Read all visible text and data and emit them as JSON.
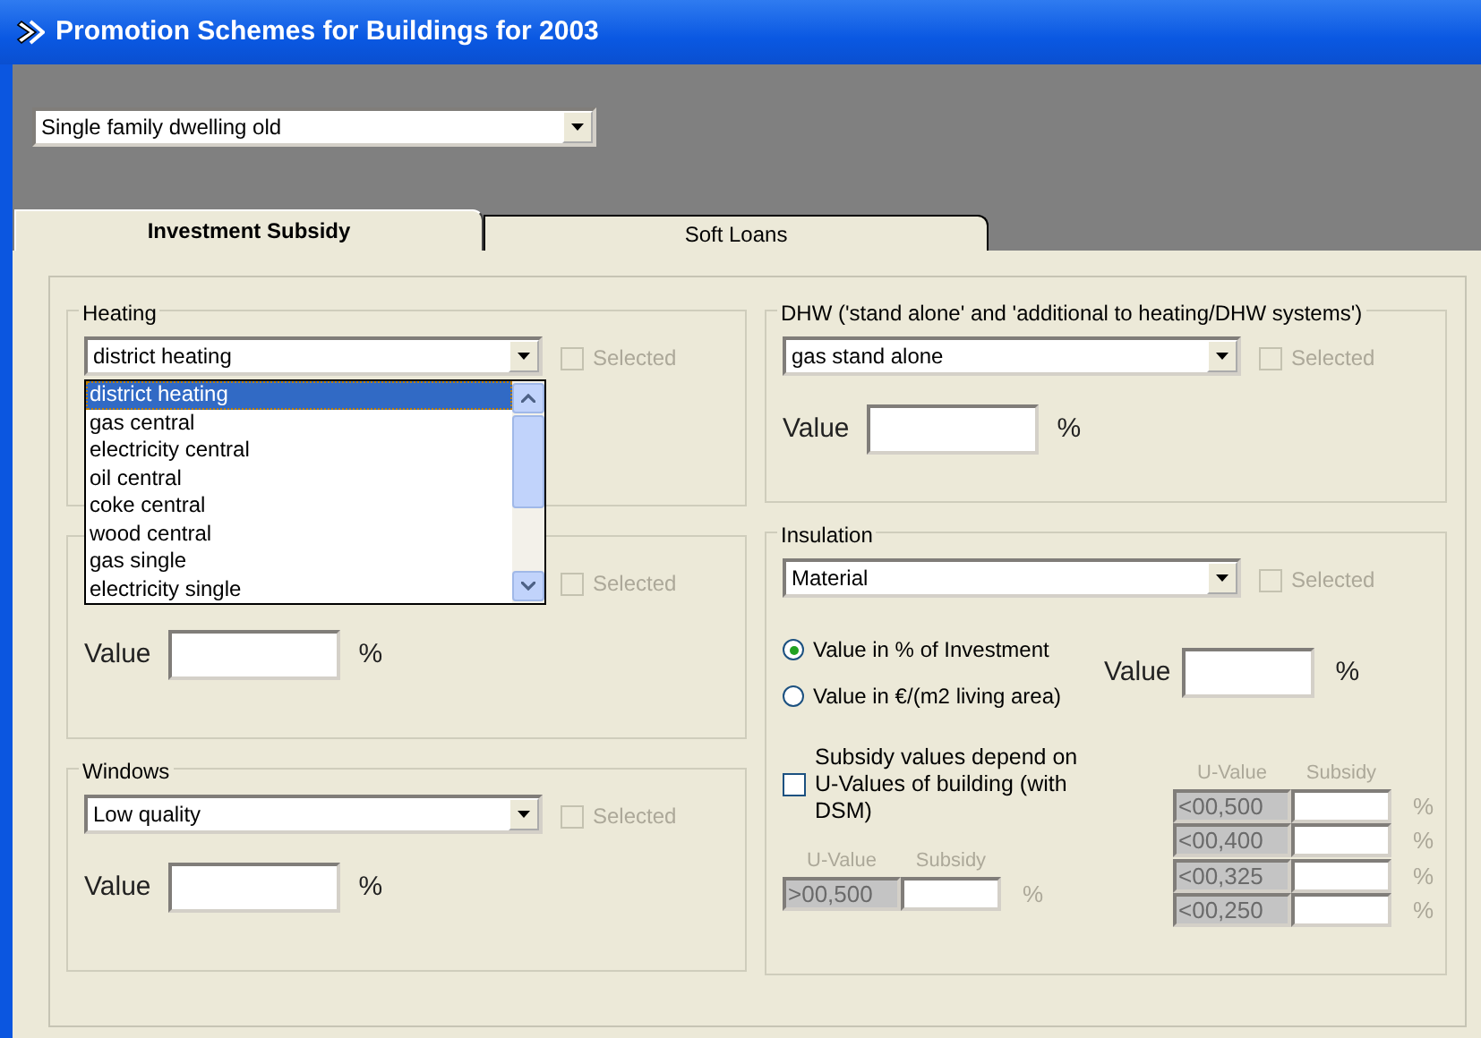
{
  "window": {
    "title": "Promotion Schemes for Buildings for 2003"
  },
  "building_type": {
    "value": "Single family dwelling old"
  },
  "tabs": [
    {
      "label": "Investment Subsidy",
      "selected": true
    },
    {
      "label": "Soft Loans",
      "selected": false
    }
  ],
  "left_column": [
    {
      "kind": "measure",
      "title": "Heating",
      "select": "district heating",
      "checkbox": {
        "label": "Selected",
        "checked": false,
        "disabled": true
      },
      "open_list": {
        "items": [
          {
            "label": "district heating",
            "selected": true
          },
          {
            "label": "gas central",
            "selected": false
          },
          {
            "label": "electricity central",
            "selected": false
          },
          {
            "label": "oil central",
            "selected": false
          },
          {
            "label": "coke central",
            "selected": false
          },
          {
            "label": "wood central",
            "selected": false
          },
          {
            "label": "gas single",
            "selected": false
          },
          {
            "label": "electricity single",
            "selected": false
          }
        ]
      }
    },
    {
      "kind": "measure",
      "checkbox": {
        "label": "Selected",
        "checked": false,
        "disabled": true
      },
      "value_label": "Value",
      "unit": "%"
    },
    {
      "kind": "measure",
      "title": "Windows",
      "select": "Low quality",
      "checkbox": {
        "label": "Selected",
        "checked": false,
        "disabled": true
      },
      "value_label": "Value",
      "unit": "%"
    }
  ],
  "right_column": [
    {
      "kind": "measure",
      "title": "DHW ('stand alone' and 'additional to heating/DHW systems')",
      "select": "gas stand alone",
      "checkbox": {
        "label": "Selected",
        "checked": false,
        "disabled": true
      },
      "value_label": "Value",
      "unit": "%"
    },
    {
      "kind": "insulation",
      "title": "Insulation",
      "select": "Material",
      "checkbox": {
        "label": "Selected",
        "checked": false,
        "disabled": true
      },
      "radios": [
        {
          "label": "Value in % of Investment",
          "selected": true
        },
        {
          "label": "Value in €/(m2 living area)",
          "selected": false
        }
      ],
      "value_label": "Value",
      "unit": "%",
      "dsm_checkbox": {
        "label": "Subsidy values depend on U-Values of building (with DSM)",
        "checked": false
      },
      "single_table": {
        "headers": [
          "U-Value",
          "Subsidy"
        ],
        "rows": [
          {
            "u_value": ">00,500",
            "unit": "%"
          }
        ]
      },
      "multi_table": {
        "headers": [
          "U-Value",
          "Subsidy"
        ],
        "rows": [
          {
            "u_value": "<00,500",
            "unit": "%"
          },
          {
            "u_value": "<00,400",
            "unit": "%"
          },
          {
            "u_value": "<00,325",
            "unit": "%"
          },
          {
            "u_value": "<00,250",
            "unit": "%"
          }
        ]
      }
    }
  ]
}
